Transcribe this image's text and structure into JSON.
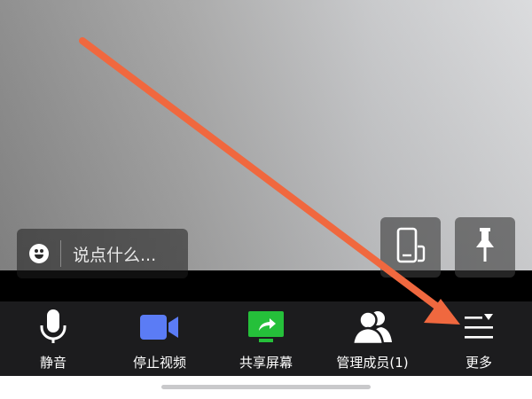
{
  "chat": {
    "placeholder": "说点什么...",
    "emoji_icon": "emoji-smile-icon"
  },
  "floating_buttons": [
    {
      "icon": "screen-rotate-icon"
    },
    {
      "icon": "pin-icon"
    }
  ],
  "toolbar": {
    "items": [
      {
        "label": "静音",
        "icon": "microphone-icon",
        "color": "#ffffff"
      },
      {
        "label": "停止视频",
        "icon": "video-camera-icon",
        "color": "#5b7cf5"
      },
      {
        "label": "共享屏幕",
        "icon": "share-screen-icon",
        "color": "#25c03a"
      },
      {
        "label": "管理成员(1)",
        "icon": "participants-icon",
        "color": "#ffffff"
      },
      {
        "label": "更多",
        "icon": "more-menu-icon",
        "color": "#ffffff"
      }
    ]
  },
  "colors": {
    "toolbar_bg": "#1c1c1e",
    "annotation_arrow": "#f0683f"
  }
}
